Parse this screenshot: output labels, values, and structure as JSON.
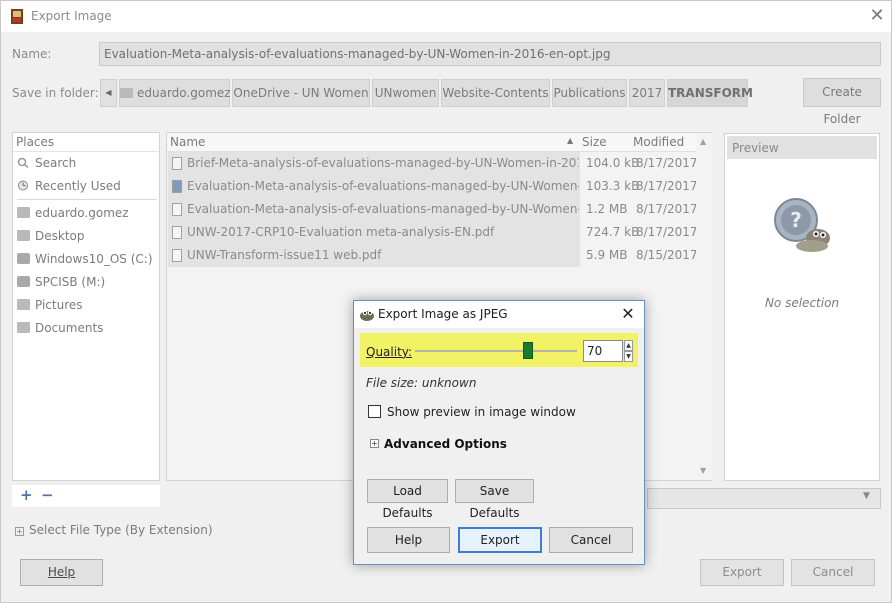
{
  "window": {
    "title": "Export Image",
    "close_glyph": "✕"
  },
  "name_row": {
    "label": "Name:",
    "value": "Evaluation-Meta-analysis-of-evaluations-managed-by-UN-Women-in-2016-en-opt.jpg"
  },
  "folder_row": {
    "label": "Save in folder:",
    "back_glyph": "◀",
    "crumbs": [
      "eduardo.gomez",
      "OneDrive - UN Women",
      "UNwomen",
      "Website-Contents",
      "Publications",
      "2017",
      "TRANSFORM"
    ],
    "create_folder": "Create Folder"
  },
  "places": {
    "header": "Places",
    "items": [
      "Search",
      "Recently Used",
      "eduardo.gomez",
      "Desktop",
      "Windows10_OS (C:)",
      "SPCISB (M:)",
      "Pictures",
      "Documents"
    ],
    "add_glyph": "+",
    "remove_glyph": "−"
  },
  "files": {
    "col_name": "Name",
    "col_size": "Size",
    "col_modified": "Modified",
    "sort_glyph": "▲",
    "rows": [
      {
        "name": "Brief-Meta-analysis-of-evaluations-managed-by-UN-Women-in-2016-e...",
        "size": "104.0 kB",
        "modified": "8/17/2017"
      },
      {
        "name": "Evaluation-Meta-analysis-of-evaluations-managed-by-UN-Women-in-...",
        "size": "103.3 kB",
        "modified": "8/17/2017"
      },
      {
        "name": "Evaluation-Meta-analysis-of-evaluations-managed-by-UN-Women-in-...",
        "size": "1.2 MB",
        "modified": "8/17/2017"
      },
      {
        "name": "UNW-2017-CRP10-Evaluation meta-analysis-EN.pdf",
        "size": "724.7 kB",
        "modified": "8/17/2017"
      },
      {
        "name": "UNW-Transform-issue11 web.pdf",
        "size": "5.9 MB",
        "modified": "8/15/2017"
      }
    ]
  },
  "preview": {
    "header": "Preview",
    "empty_text": "No selection"
  },
  "select_file_type": {
    "expander": "+",
    "label": "Select File Type (By Extension)"
  },
  "buttons": {
    "help": "Help",
    "export": "Export",
    "cancel": "Cancel"
  },
  "jpeg_dialog": {
    "title": "Export Image as JPEG",
    "close_glyph": "✕",
    "quality_label": "Quality:",
    "quality_value": "70",
    "quality_fraction": 0.7,
    "spin_up": "▲",
    "spin_down": "▼",
    "file_size": "File size: unknown",
    "show_preview_label": "Show preview in image window",
    "show_preview_checked": false,
    "advanced_expander": "+",
    "advanced_label": "Advanced Options",
    "load_defaults": "Load Defaults",
    "save_defaults": "Save Defaults",
    "help": "Help",
    "export": "Export",
    "cancel": "Cancel"
  },
  "colors": {
    "quality_highlight": "#f2f266",
    "slider_knob": "#1a7a2e",
    "focus_border": "#3c7fd1",
    "dialog_border": "#6b8fc5"
  },
  "icons": {
    "app": "gimp-export-icon",
    "dialog": "gimp-wilber-icon",
    "preview": "unknown-file-help-icon"
  }
}
